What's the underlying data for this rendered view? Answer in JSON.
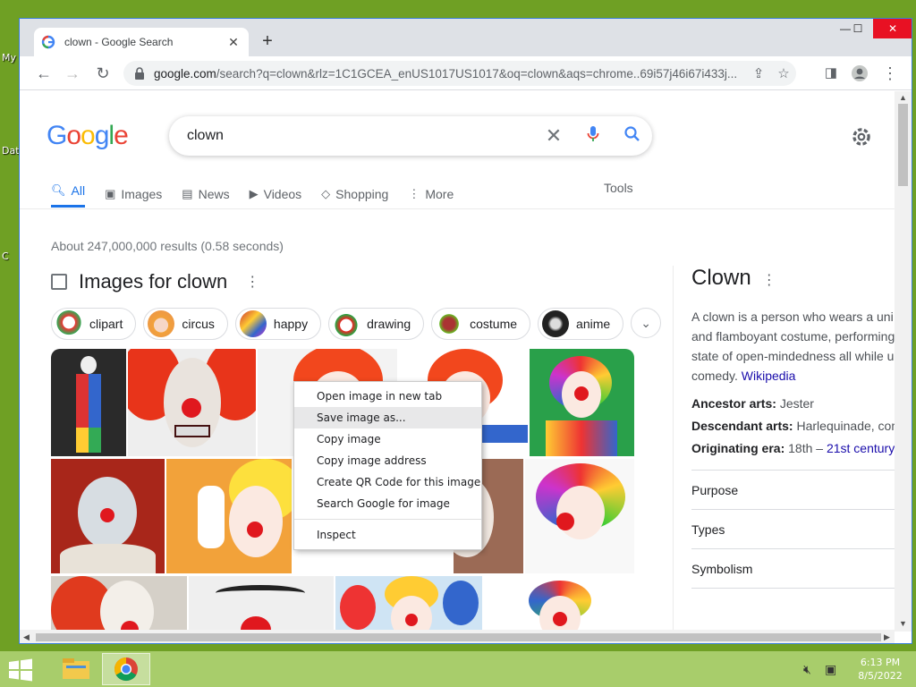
{
  "desktop": {
    "icon_labels": [
      "My",
      "Dat",
      "C"
    ]
  },
  "browser": {
    "tab_title": "clown - Google Search",
    "tab_close": "✕",
    "new_tab": "+",
    "url_host": "google.com",
    "url_rest": "/search?q=clown&rlz=1C1GCEA_enUS1017US1017&oq=clown&aqs=chrome..69i57j46i67i433j...",
    "window_controls": {
      "minimize": "—",
      "maximize": "☐",
      "close": "✕"
    }
  },
  "search": {
    "query": "clown",
    "tabs": [
      {
        "label": "All",
        "icon": "search-icon"
      },
      {
        "label": "Images",
        "icon": "image-icon"
      },
      {
        "label": "News",
        "icon": "news-icon"
      },
      {
        "label": "Videos",
        "icon": "video-icon"
      },
      {
        "label": "Shopping",
        "icon": "tag-icon"
      },
      {
        "label": "More",
        "icon": "more-vert-icon"
      }
    ],
    "tools_label": "Tools",
    "stats": "About 247,000,000 results (0.58 seconds)"
  },
  "images_section": {
    "title": "Images for clown",
    "chips": [
      "clipart",
      "circus",
      "happy",
      "drawing",
      "costume",
      "anime"
    ]
  },
  "context_menu": {
    "items": [
      "Open image in new tab",
      "Save image as...",
      "Copy image",
      "Copy image address",
      "Create QR Code for this image",
      "Search Google for image"
    ],
    "inspect": "Inspect"
  },
  "knowledge_panel": {
    "title": "Clown",
    "desc_lines": [
      "A clown is a person who wears a uni",
      "and flamboyant costume, performing",
      "state of open-mindedness all while u",
      "comedy."
    ],
    "desc_link": "Wikipedia",
    "facts": [
      {
        "label": "Ancestor arts:",
        "value": "Jester"
      },
      {
        "label": "Descendant arts:",
        "value": "Harlequinade, com"
      }
    ],
    "era_label": "Originating era:",
    "era_value": "18th –",
    "era_link": "21st century",
    "rows": [
      "Purpose",
      "Types",
      "Symbolism"
    ]
  },
  "taskbar": {
    "time": "6:13 PM",
    "date": "8/5/2022"
  },
  "colors": {
    "desktop_bg": "#6fa024",
    "taskbar_bg": "#a8cd6b",
    "google_blue": "#4285f4",
    "google_red": "#ea4335",
    "google_yellow": "#fbbc05",
    "google_green": "#34a853",
    "link": "#1a0dab"
  }
}
